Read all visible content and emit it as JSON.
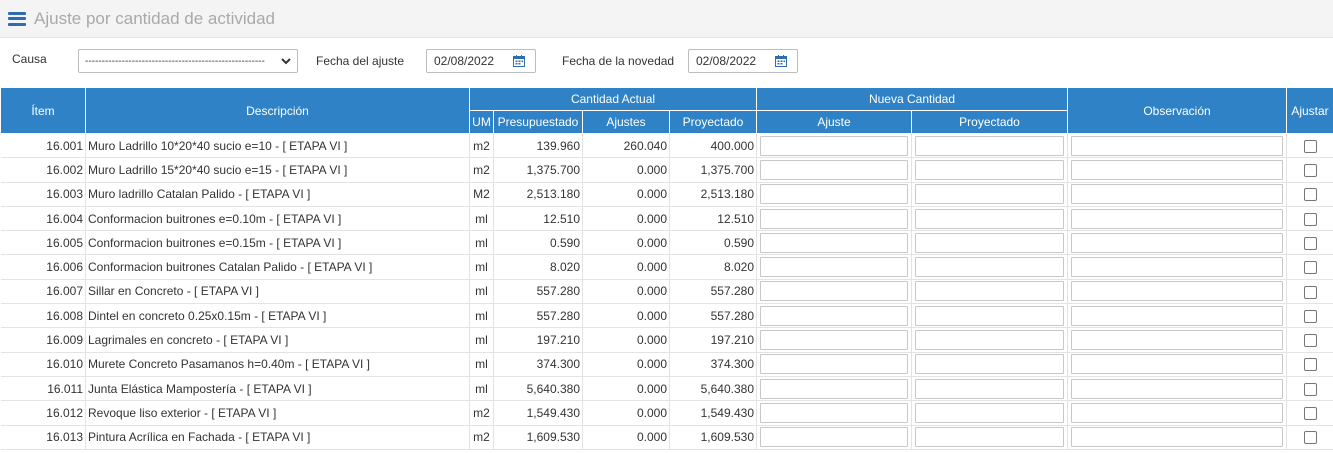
{
  "header": {
    "title": "Ajuste por cantidad de actividad",
    "menu_icon": "hamburger-menu-icon"
  },
  "filters": {
    "causa_label": "Causa",
    "causa_value": "------------------------------------------------------",
    "fecha_ajuste_label": "Fecha del ajuste",
    "fecha_ajuste_value": "02/08/2022",
    "fecha_novedad_label": "Fecha de la novedad",
    "fecha_novedad_value": "02/08/2022",
    "calendar_icon": "calendar-icon"
  },
  "colors": {
    "header_blue": "#2f82c5",
    "menu_blue": "#2f6db3"
  },
  "table": {
    "headers": {
      "item": "Ítem",
      "descripcion": "Descripción",
      "cantidad_actual": "Cantidad Actual",
      "nueva_cantidad": "Nueva Cantidad",
      "observacion": "Observación",
      "ajustar": "Ajustar",
      "um": "UM",
      "presupuestado": "Presupuestado",
      "ajustes": "Ajustes",
      "proyectado": "Proyectado",
      "ajuste": "Ajuste",
      "nuevo_proyectado": "Proyectado"
    },
    "rows": [
      {
        "item": "16.001",
        "descripcion": "Muro Ladrillo 10*20*40 sucio e=10 - [ ETAPA VI ]",
        "um": "m2",
        "presupuestado": "139.960",
        "ajustes": "260.040",
        "proyectado": "400.000"
      },
      {
        "item": "16.002",
        "descripcion": "Muro Ladrillo 15*20*40 sucio e=15 - [ ETAPA VI ]",
        "um": "m2",
        "presupuestado": "1,375.700",
        "ajustes": "0.000",
        "proyectado": "1,375.700"
      },
      {
        "item": "16.003",
        "descripcion": "Muro ladrillo Catalan Palido - [ ETAPA VI ]",
        "um": "M2",
        "presupuestado": "2,513.180",
        "ajustes": "0.000",
        "proyectado": "2,513.180"
      },
      {
        "item": "16.004",
        "descripcion": "Conformacion buitrones e=0.10m - [ ETAPA VI ]",
        "um": "ml",
        "presupuestado": "12.510",
        "ajustes": "0.000",
        "proyectado": "12.510"
      },
      {
        "item": "16.005",
        "descripcion": "Conformacion buitrones e=0.15m - [ ETAPA VI ]",
        "um": "ml",
        "presupuestado": "0.590",
        "ajustes": "0.000",
        "proyectado": "0.590"
      },
      {
        "item": "16.006",
        "descripcion": "Conformacion buitrones Catalan Palido - [ ETAPA VI ]",
        "um": "ml",
        "presupuestado": "8.020",
        "ajustes": "0.000",
        "proyectado": "8.020"
      },
      {
        "item": "16.007",
        "descripcion": "Sillar en Concreto - [ ETAPA VI ]",
        "um": "ml",
        "presupuestado": "557.280",
        "ajustes": "0.000",
        "proyectado": "557.280"
      },
      {
        "item": "16.008",
        "descripcion": "Dintel en concreto 0.25x0.15m - [ ETAPA VI ]",
        "um": "ml",
        "presupuestado": "557.280",
        "ajustes": "0.000",
        "proyectado": "557.280"
      },
      {
        "item": "16.009",
        "descripcion": "Lagrimales en concreto - [ ETAPA VI ]",
        "um": "ml",
        "presupuestado": "197.210",
        "ajustes": "0.000",
        "proyectado": "197.210"
      },
      {
        "item": "16.010",
        "descripcion": "Murete Concreto Pasamanos h=0.40m - [ ETAPA VI ]",
        "um": "ml",
        "presupuestado": "374.300",
        "ajustes": "0.000",
        "proyectado": "374.300"
      },
      {
        "item": "16.011",
        "descripcion": "Junta Elástica Mampostería - [ ETAPA VI ]",
        "um": "ml",
        "presupuestado": "5,640.380",
        "ajustes": "0.000",
        "proyectado": "5,640.380"
      },
      {
        "item": "16.012",
        "descripcion": "Revoque liso exterior - [ ETAPA VI ]",
        "um": "m2",
        "presupuestado": "1,549.430",
        "ajustes": "0.000",
        "proyectado": "1,549.430"
      },
      {
        "item": "16.013",
        "descripcion": "Pintura Acrílica en Fachada - [ ETAPA VI ]",
        "um": "m2",
        "presupuestado": "1,609.530",
        "ajustes": "0.000",
        "proyectado": "1,609.530"
      }
    ]
  }
}
